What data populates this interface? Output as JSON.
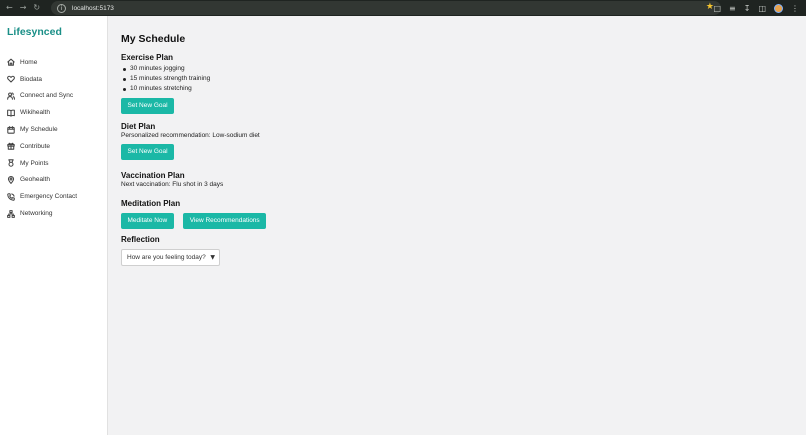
{
  "browser": {
    "url": "localhost:5173",
    "icons": [
      "back-icon",
      "forward-icon",
      "reload-icon",
      "site-info-icon",
      "star-icon",
      "extensions-icon",
      "downloads-icon",
      "profile-icon",
      "menu-icon"
    ]
  },
  "app": {
    "name": "Lifesynced"
  },
  "sidebar": {
    "items": [
      {
        "label": "Home",
        "icon": "home-icon"
      },
      {
        "label": "Biodata",
        "icon": "heart-icon"
      },
      {
        "label": "Connect and Sync",
        "icon": "users-icon"
      },
      {
        "label": "Wikihealth",
        "icon": "book-icon"
      },
      {
        "label": "My Schedule",
        "icon": "calendar-icon"
      },
      {
        "label": "Contribute",
        "icon": "gift-icon"
      },
      {
        "label": "My Points",
        "icon": "medal-icon"
      },
      {
        "label": "Geohealth",
        "icon": "map-pin-icon"
      },
      {
        "label": "Emergency Contact",
        "icon": "phone-icon"
      },
      {
        "label": "Networking",
        "icon": "network-icon"
      }
    ]
  },
  "main": {
    "title": "My Schedule",
    "exercise": {
      "heading": "Exercise Plan",
      "items": [
        "30 minutes jogging",
        "15 minutes strength training",
        "10 minutes stretching"
      ],
      "button": "Set New Goal"
    },
    "diet": {
      "heading": "Diet Plan",
      "text": "Personalized recommendation: Low-sodium diet",
      "button": "Set New Goal"
    },
    "vaccination": {
      "heading": "Vaccination Plan",
      "text": "Next vaccination: Flu shot in 3 days"
    },
    "meditation": {
      "heading": "Meditation Plan",
      "button_primary": "Meditate Now",
      "button_secondary": "View Recommendations"
    },
    "reflection": {
      "heading": "Reflection",
      "select_value": "How are you feeling today?"
    }
  },
  "colors": {
    "accent": "#1bb8a6",
    "brand": "#1a8f87",
    "background": "#f2f2f3"
  }
}
